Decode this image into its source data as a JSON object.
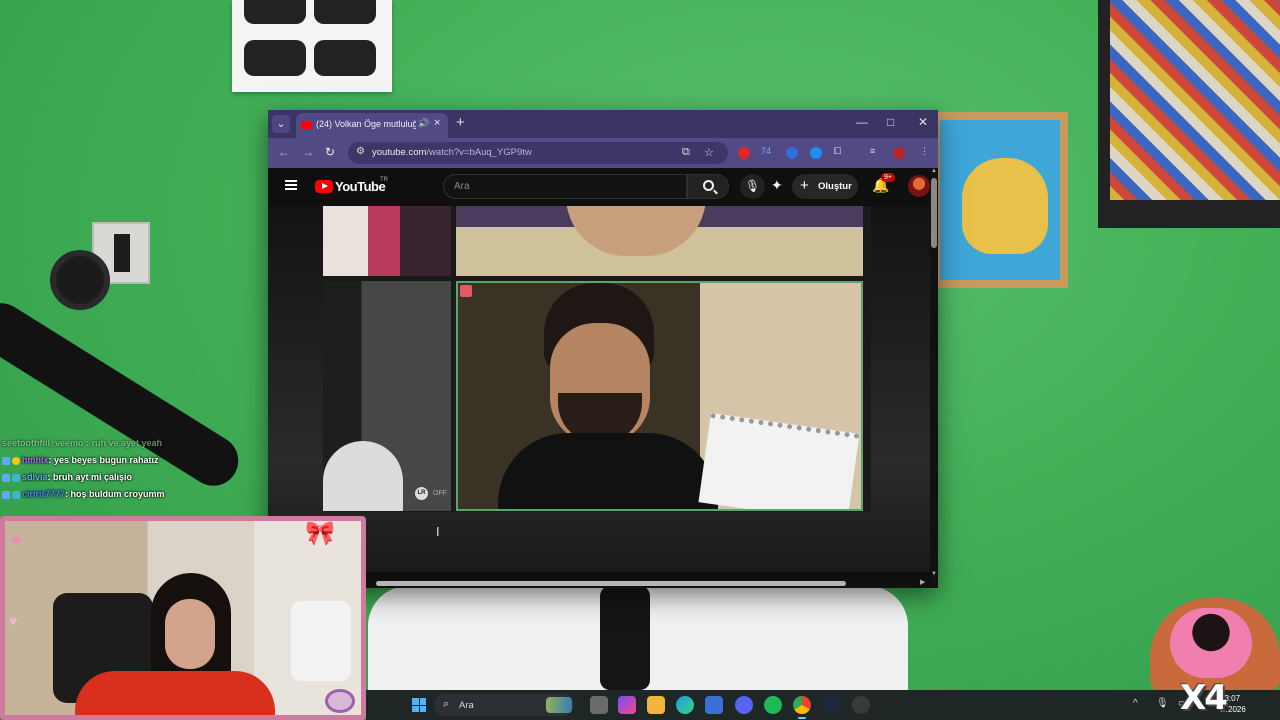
{
  "browser": {
    "tab_title": "(24) Volkan Öge mutluluğu",
    "url_host": "youtube.com",
    "url_path": "/watch?v=bAuq_YGP9tw",
    "window_controls": {
      "minimize": "—",
      "maximize": "□",
      "close": "✕"
    },
    "new_tab": "+",
    "extension_count": "74"
  },
  "youtube": {
    "logo_text": "YouTube",
    "region": "TR",
    "search_placeholder": "Ara",
    "create_label": "Oluştur",
    "notification_badge": "9+",
    "overlay_off": "OFF",
    "overlay_lr": "LR"
  },
  "chat": {
    "faded_line": "seetoothfill_veemo : ruh ve ayet  yeah",
    "messages": [
      {
        "user": "hmhlx",
        "text": ": yes beyes bugun rahatız"
      },
      {
        "user": "sdlvia",
        "text": ": bruh ayt mi çalışio"
      },
      {
        "user": "ciririr7777",
        "text": ": hoş buldum croyumm"
      }
    ]
  },
  "taskbar": {
    "search_placeholder": "Ara",
    "time": "23:07",
    "date": "…2026"
  },
  "overlay_text": "X4",
  "colors": {
    "titlebar": "#3b3566",
    "toolbar": "#514a85",
    "youtube_red": "#ff0000",
    "wall_green": "#43b058",
    "webcam_border": "#d07aa0"
  }
}
